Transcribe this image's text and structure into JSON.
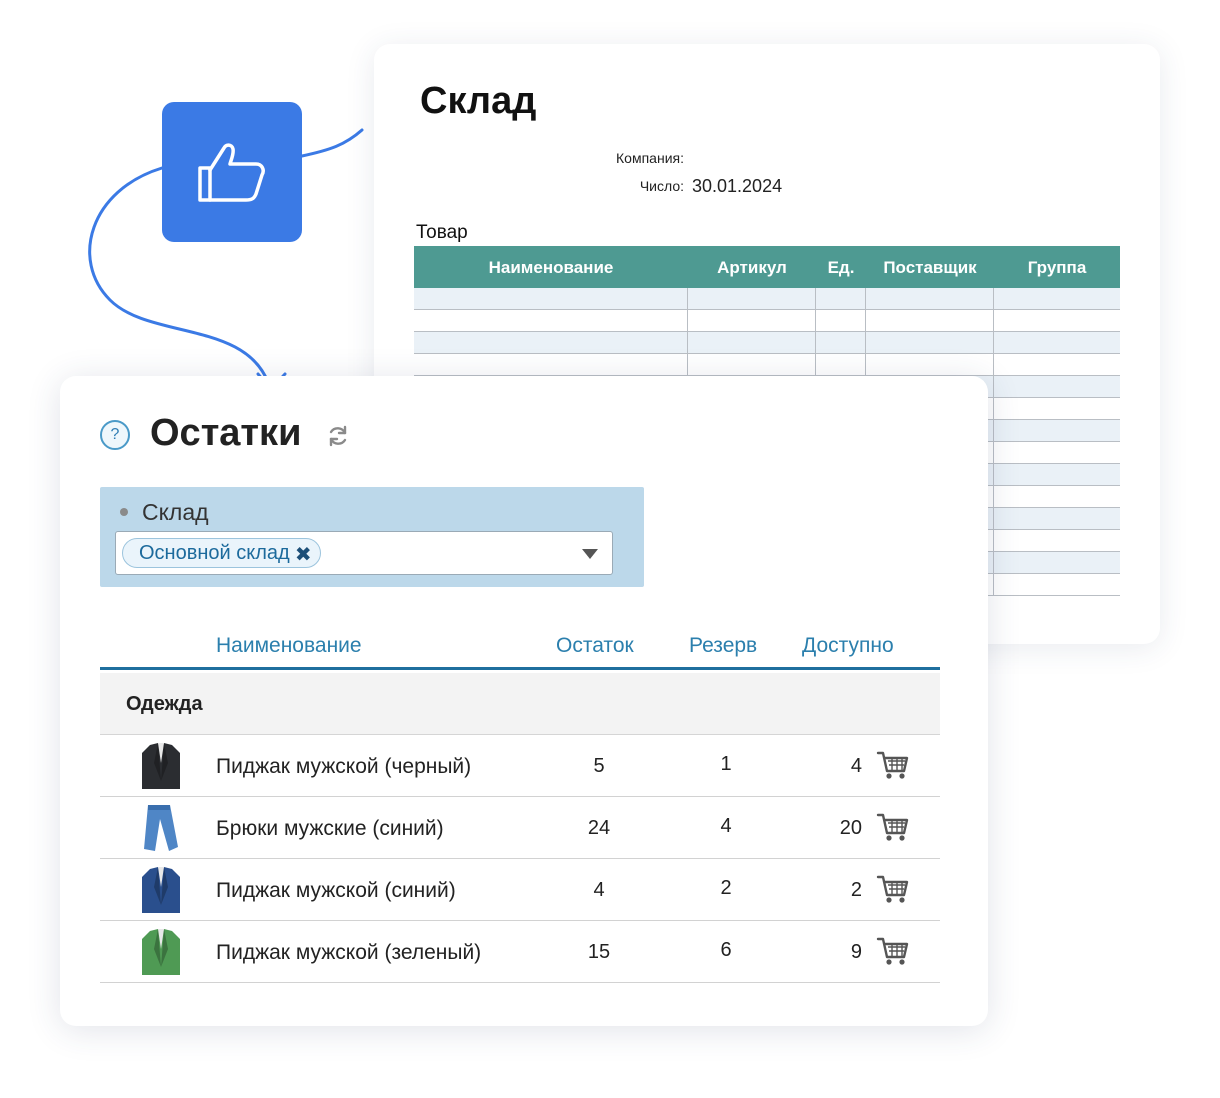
{
  "document": {
    "title": "Склад",
    "company_label": "Компания:",
    "date_label": "Число:",
    "date_value": "30.01.2024",
    "section_label": "Товар",
    "columns": [
      "Наименование",
      "Артикул",
      "Ед.",
      "Поставщик",
      "Группа"
    ]
  },
  "stock": {
    "title": "Остатки",
    "help_glyph": "?",
    "filter": {
      "label": "Склад",
      "selected_chip": "Основной склад",
      "chip_remove_glyph": "✖"
    },
    "columns": {
      "name": "Наименование",
      "remain": "Остаток",
      "reserve": "Резерв",
      "available": "Доступно"
    },
    "group": "Одежда",
    "rows": [
      {
        "name": "Пиджак мужской (черный)",
        "remain": "5",
        "reserve": "1",
        "available": "4",
        "image": "black-jacket",
        "color": "#2b2d31"
      },
      {
        "name": "Брюки мужские (синий)",
        "remain": "24",
        "reserve": "4",
        "available": "20",
        "image": "blue-trousers",
        "color": "#4f86c6"
      },
      {
        "name": "Пиджак мужской (синий)",
        "remain": "4",
        "reserve": "2",
        "available": "2",
        "image": "blue-jacket",
        "color": "#2a4f8d"
      },
      {
        "name": "Пиджак мужской (зеленый)",
        "remain": "15",
        "reserve": "6",
        "available": "9",
        "image": "green-jacket",
        "color": "#4f9a54"
      }
    ]
  },
  "colors": {
    "accent_blue": "#3b7ae5",
    "doc_header": "#4e9a92",
    "filter_bg": "#bcd8ea",
    "link_blue": "#2b7fad"
  }
}
